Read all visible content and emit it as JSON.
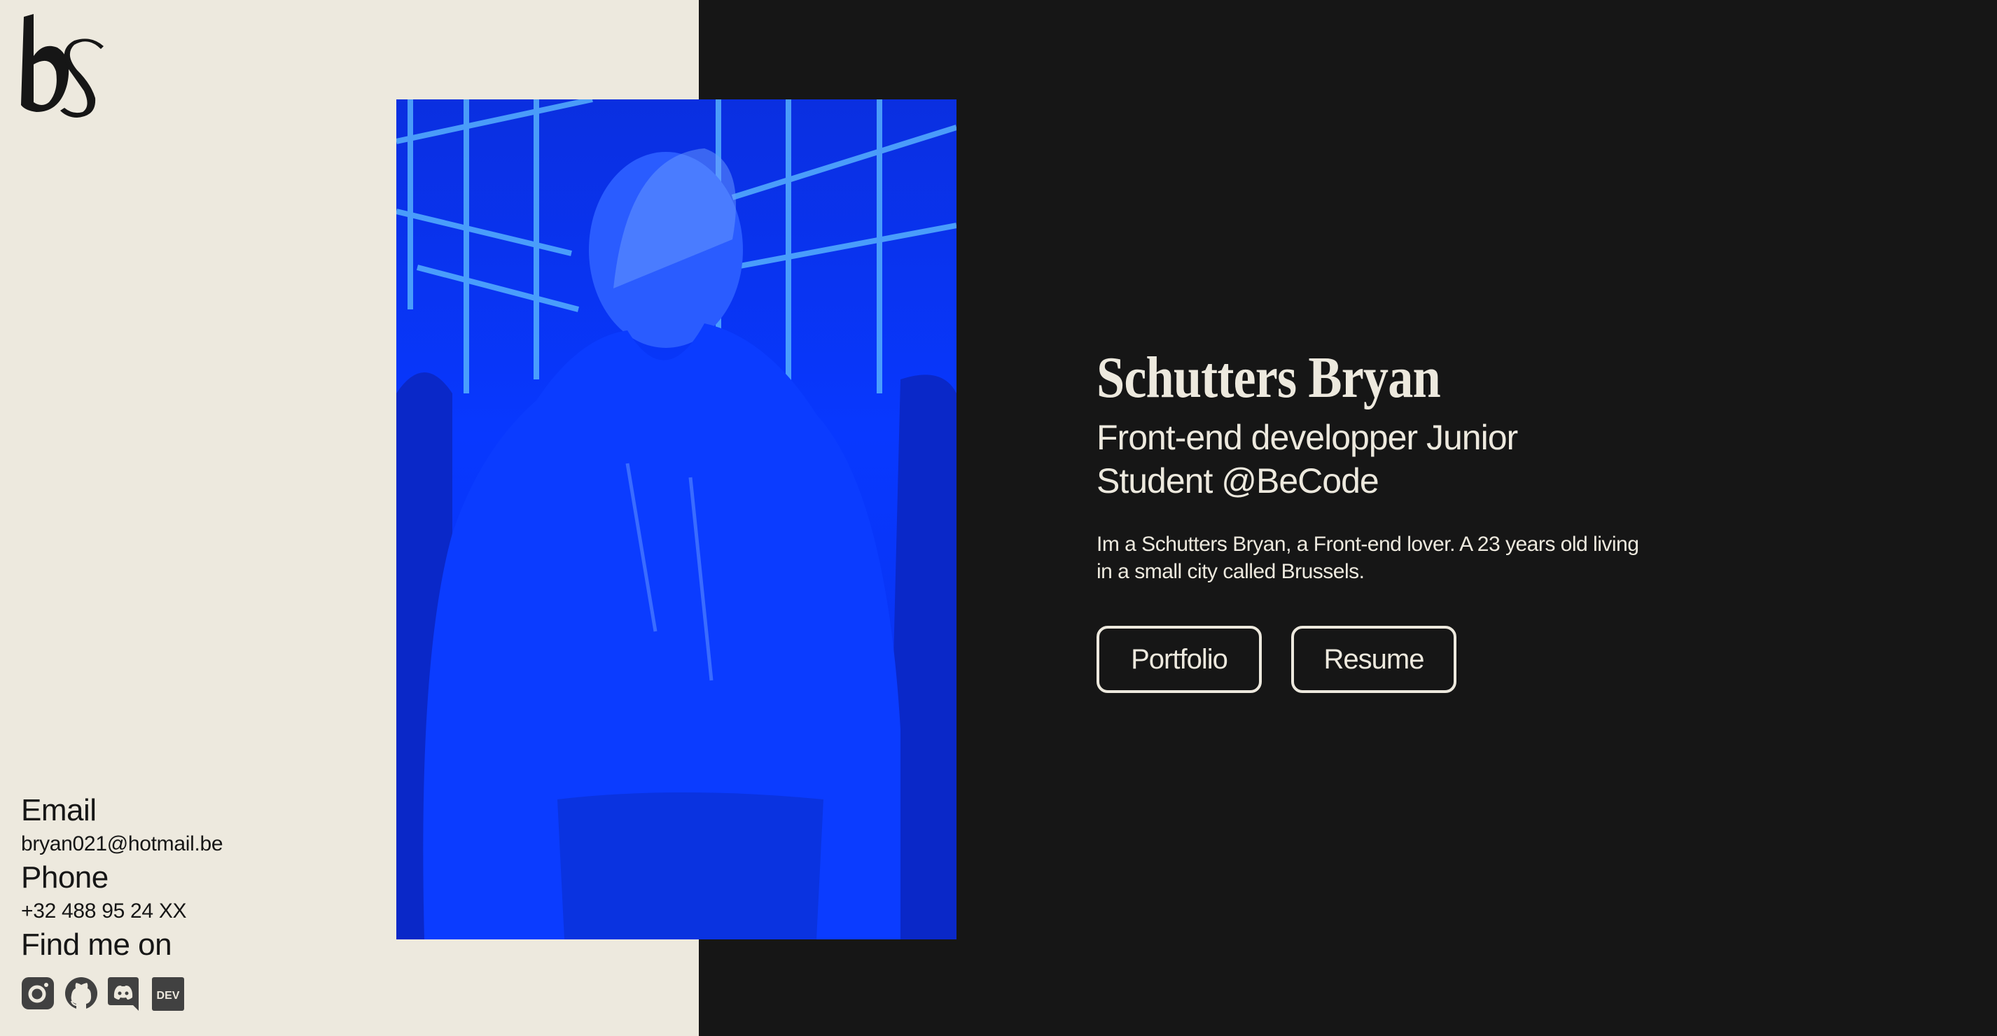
{
  "logo": {
    "text": "bs"
  },
  "profile": {
    "name": "Schutters Bryan",
    "subtitle_line1": "Front-end developper Junior",
    "subtitle_line2": "Student @BeCode",
    "bio": "Im a Schutters Bryan, a Front-end lover. A 23 years old living in a small city called Brussels.",
    "buttons": [
      {
        "label": "Portfolio"
      },
      {
        "label": "Resume"
      }
    ]
  },
  "contact": {
    "email_label": "Email",
    "email": "bryan021@hotmail.be",
    "phone_label": "Phone",
    "phone": "+32 488 95 24 XX",
    "social_label": "Find me on",
    "social": [
      "instagram-icon",
      "github-icon",
      "discord-icon",
      "dev-icon"
    ]
  },
  "colors": {
    "light": "#ede9de",
    "dark": "#161616",
    "photo_tint": "#0838ff",
    "icon": "#414141"
  }
}
